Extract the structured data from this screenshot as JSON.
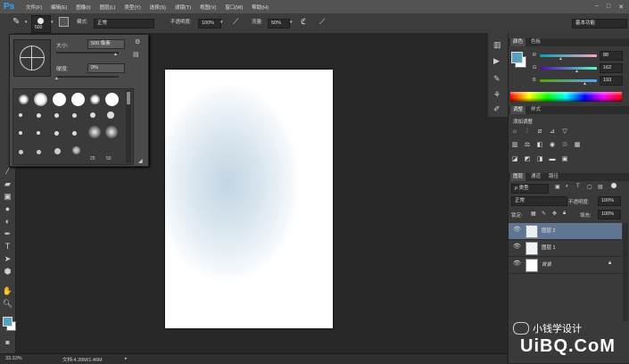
{
  "app": {
    "logo": "Ps"
  },
  "menu": [
    "文件(F)",
    "编辑(E)",
    "图像(I)",
    "图层(L)",
    "类型(Y)",
    "选择(S)",
    "滤镜(T)",
    "视图(V)",
    "窗口(W)",
    "帮助(H)"
  ],
  "window_controls": [
    "−",
    "□",
    "✕"
  ],
  "options": {
    "brush_size": "500",
    "mode_label": "模式:",
    "mode_value": "正常",
    "opacity_label": "不透明度:",
    "opacity_value": "100%",
    "flow_label": "流量:",
    "flow_value": "50%",
    "workspace": "基本功能"
  },
  "brush_popup": {
    "size_label": "大小:",
    "size_value": "500 像素",
    "hardness_label": "硬度:",
    "hardness_value": "0%",
    "preset_sizes": [
      "25",
      "50"
    ]
  },
  "status": {
    "zoom": "33.33%",
    "doc": "文档:4.39M/1.46M"
  },
  "color_panel": {
    "tabs": [
      "颜色",
      "色板"
    ],
    "r_label": "R",
    "r_value": "88",
    "g_label": "G",
    "g_value": "162",
    "b_label": "B",
    "b_value": "193",
    "fg_color": "#58a2c1"
  },
  "adjust_panel": {
    "tabs": [
      "调整",
      "样式"
    ],
    "title": "添加调整"
  },
  "layers_panel": {
    "tabs": [
      "图层",
      "通道",
      "路径"
    ],
    "filter": "类型",
    "blend_mode": "正常",
    "opacity_label": "不透明度:",
    "opacity_value": "100%",
    "lock_label": "锁定:",
    "fill_label": "填充:",
    "fill_value": "100%",
    "layers": [
      {
        "name": "图层 2",
        "selected": true
      },
      {
        "name": "图层 1",
        "selected": false
      },
      {
        "name": "背景",
        "selected": false
      }
    ]
  },
  "watermark": {
    "line1": "小钱学设计",
    "line2": "UiBQ.CoM"
  }
}
